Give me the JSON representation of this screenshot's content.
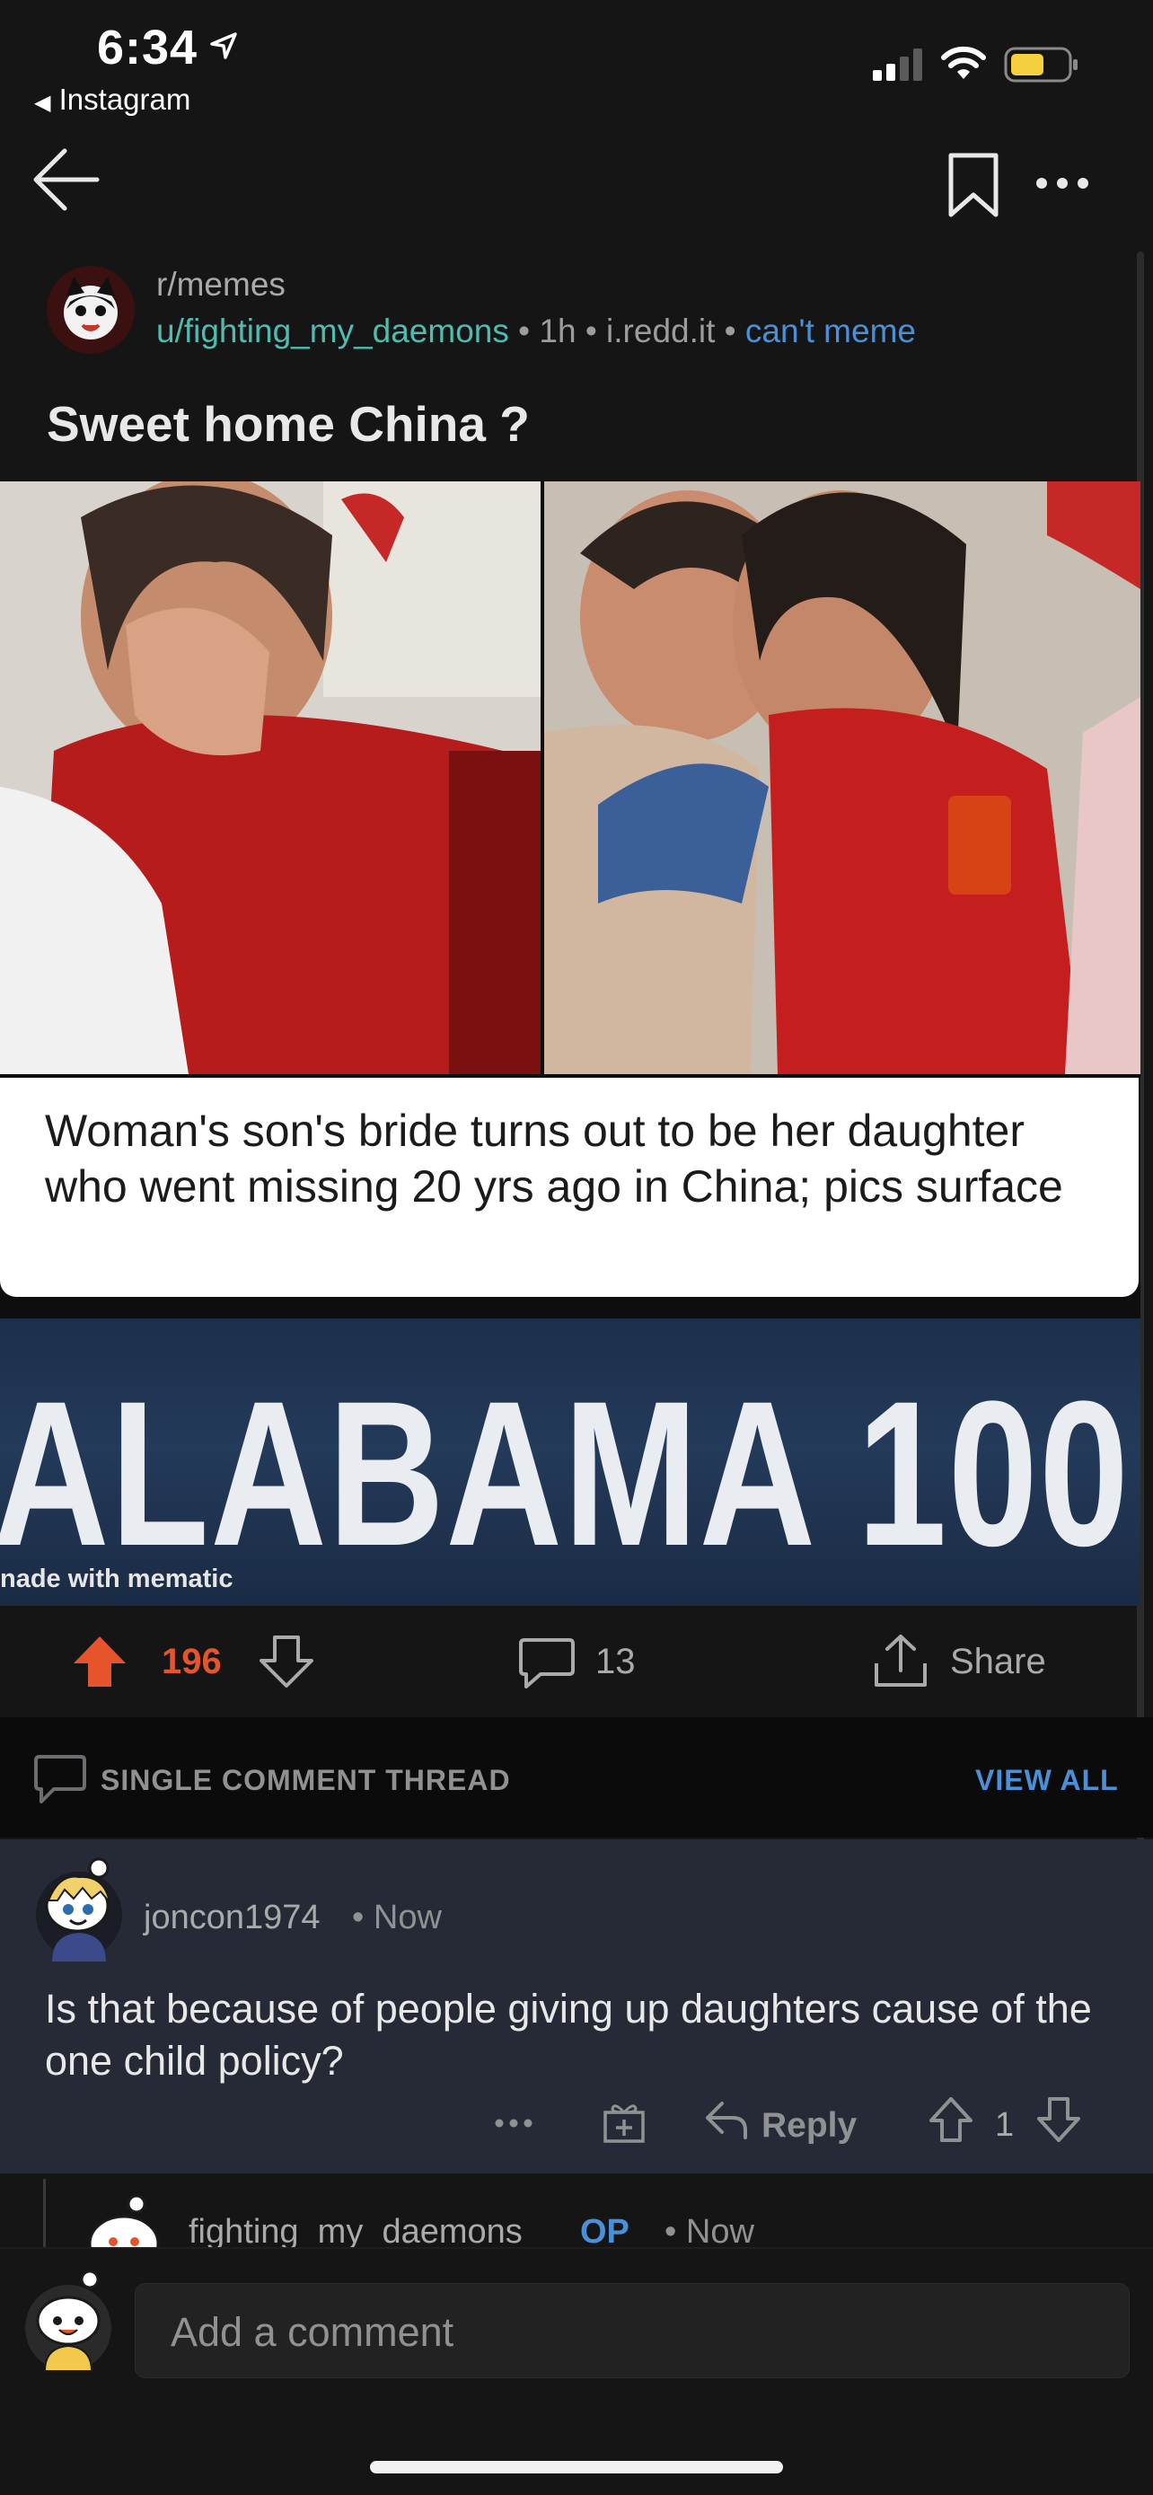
{
  "status": {
    "time": "6:34",
    "back_app": "Instagram"
  },
  "post": {
    "subreddit": "r/memes",
    "author": "u/fighting_my_daemons",
    "age": "1h",
    "domain": "i.redd.it",
    "flair": "can't meme",
    "title": "Sweet home China ?",
    "image_caption": "Woman's son's bride turns out to be her daughter who went missing 20 yrs ago in China; pics surface",
    "image_banner": "ALABAMA 100",
    "image_watermark": "nade with mematic",
    "score": "196",
    "comment_count": "13",
    "share_label": "Share"
  },
  "thread": {
    "label": "SINGLE COMMENT THREAD",
    "view_all": "VIEW ALL"
  },
  "comment": {
    "author": "joncon1974",
    "time": "Now",
    "body": "Is that because of people giving up daughters cause of the one child policy?",
    "reply_label": "Reply",
    "score": "1"
  },
  "nested_comment": {
    "author": "fighting_my_daemons",
    "badge": "OP",
    "time": "Now"
  },
  "composer": {
    "placeholder": "Add a comment"
  },
  "colors": {
    "upvote": "#e5542b",
    "link": "#4a90d9",
    "username": "#4fbcb0"
  }
}
